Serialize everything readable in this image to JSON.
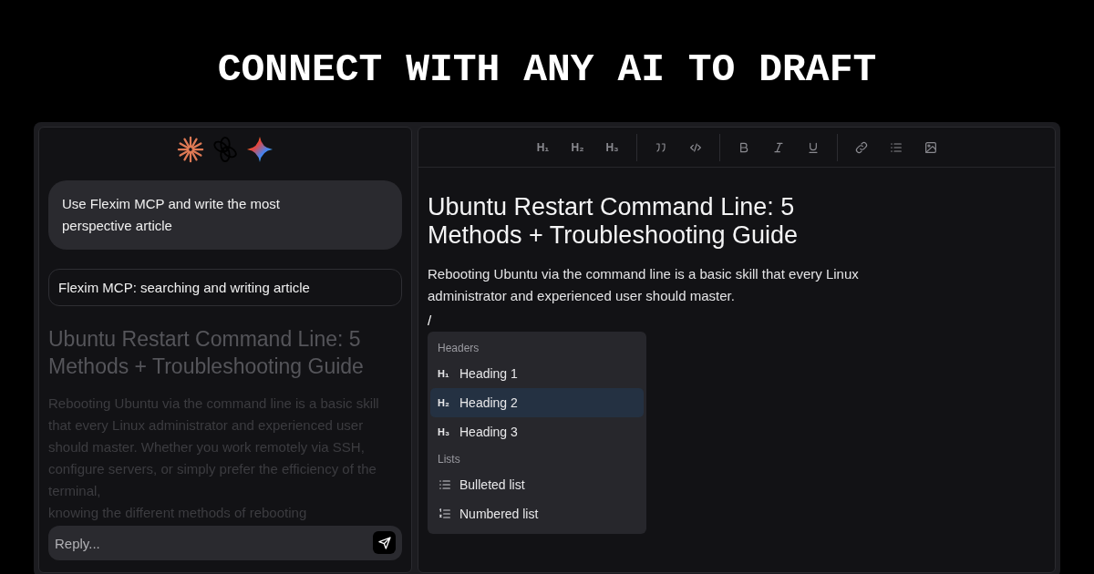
{
  "headline": "CONNECT WITH ANY AI TO DRAFT",
  "chat": {
    "user_message": "Use Flexim MCP and write the most perspective article",
    "status": "Flexim MCP: searching and writing article",
    "preview": {
      "title": "Ubuntu Restart Command Line: 5 Methods + Troubleshooting Guide",
      "paragraphs": [
        "Rebooting Ubuntu via the command line is a basic skill that every Linux administrator and experienced user should master. Whether you work remotely via SSH, configure servers, or simply prefer the efficiency of the terminal,",
        "knowing the different methods of rebooting"
      ]
    },
    "reply": {
      "placeholder": "Reply..."
    }
  },
  "editor": {
    "heading_buttons": [
      "H₁",
      "H₂",
      "H₃"
    ],
    "title": "Ubuntu Restart Command Line: 5 Methods + Troubleshooting Guide",
    "body": "Rebooting Ubuntu via the command line is a basic skill that every Linux administrator and experienced user should master.",
    "slash": "/",
    "menu": {
      "sections": [
        {
          "label": "Headers",
          "items": [
            {
              "kind": "heading",
              "marker": "H₁",
              "label": "Heading 1",
              "selected": false
            },
            {
              "kind": "heading",
              "marker": "H₂",
              "label": "Heading 2",
              "selected": true
            },
            {
              "kind": "heading",
              "marker": "H₃",
              "label": "Heading 3",
              "selected": false
            }
          ]
        },
        {
          "label": "Lists",
          "items": [
            {
              "kind": "bulleted",
              "label": "Bulleted list",
              "selected": false
            },
            {
              "kind": "numbered",
              "label": "Numbered list",
              "selected": false
            }
          ]
        }
      ]
    }
  }
}
